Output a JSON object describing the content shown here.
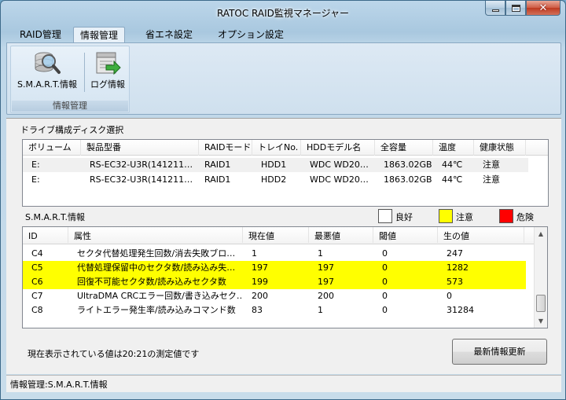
{
  "window": {
    "title": "RATOC RAID監視マネージャー"
  },
  "menu": {
    "tabs": [
      "RAID管理",
      "情報管理",
      "省エネ設定",
      "オプション設定"
    ],
    "active": 1
  },
  "ribbon": {
    "buttons": [
      {
        "label": "S.M.A.R.T.情報",
        "icon": "disk-magnifier-icon"
      },
      {
        "label": "ログ情報",
        "icon": "log-icon"
      }
    ],
    "group_label": "情報管理"
  },
  "drives": {
    "label": "ドライブ構成ディスク選択",
    "columns": [
      "ボリューム",
      "製品型番",
      "RAIDモード",
      "トレイNo.",
      "HDDモデル名",
      "全容量",
      "温度",
      "健康状態"
    ],
    "rows": [
      [
        "E:",
        "RS-EC32-U3R(141211…",
        "RAID1",
        "HDD1",
        "WDC WD20…",
        "1863.02GB",
        "44℃",
        "注意"
      ],
      [
        "E:",
        "RS-EC32-U3R(141211…",
        "RAID1",
        "HDD2",
        "WDC WD20…",
        "1863.02GB",
        "44℃",
        "注意"
      ]
    ]
  },
  "smart": {
    "label": "S.M.A.R.T.情報",
    "legend": [
      {
        "label": "良好",
        "color": "#ffffff"
      },
      {
        "label": "注意",
        "color": "#ffff00"
      },
      {
        "label": "危険",
        "color": "#ff0000"
      }
    ],
    "columns": [
      "ID",
      "属性",
      "現在値",
      "最悪値",
      "閾値",
      "生の値"
    ],
    "rows": [
      {
        "cells": [
          "C4",
          "セクタ代替処理発生回数/消去失敗ブロ…",
          "1",
          "1",
          "0",
          "247"
        ],
        "status": "good"
      },
      {
        "cells": [
          "C5",
          "代替処理保留中のセクタ数/読み込み失…",
          "197",
          "197",
          "0",
          "1282"
        ],
        "status": "warn"
      },
      {
        "cells": [
          "C6",
          "回復不可能セクタ数/読み込みセクタ数",
          "199",
          "197",
          "0",
          "573"
        ],
        "status": "warn"
      },
      {
        "cells": [
          "C7",
          "UltraDMA CRCエラー回数/書き込みセク…",
          "200",
          "200",
          "0",
          "0"
        ],
        "status": "good"
      },
      {
        "cells": [
          "C8",
          "ライトエラー発生率/読み込みコマンド数",
          "83",
          "1",
          "0",
          "31284"
        ],
        "status": "good"
      }
    ]
  },
  "status_text": "現在表示されている値は20:21の測定値です",
  "refresh_label": "最新情報更新",
  "statusbar": "情報管理:S.M.A.R.T.情報"
}
